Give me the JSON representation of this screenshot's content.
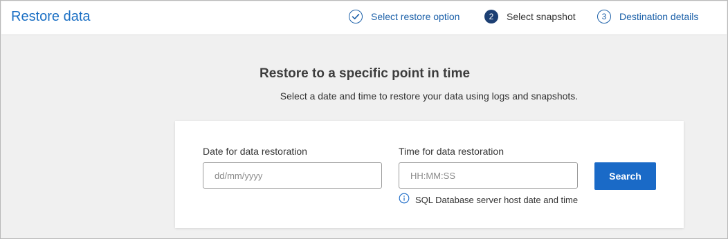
{
  "header": {
    "title": "Restore data",
    "steps": [
      {
        "number": "✓",
        "label": "Select restore option",
        "state": "complete"
      },
      {
        "number": "2",
        "label": "Select snapshot",
        "state": "current"
      },
      {
        "number": "3",
        "label": "Destination details",
        "state": "upcoming"
      }
    ]
  },
  "main": {
    "heading": "Restore to a specific point in time",
    "subheading": "Select a date and time to restore your data using logs and snapshots."
  },
  "form": {
    "date_label": "Date for data restoration",
    "date_placeholder": "dd/mm/yyyy",
    "date_value": "",
    "time_label": "Time for data restoration",
    "time_placeholder": "HH:MM:SS",
    "time_value": "",
    "search_label": "Search",
    "time_hint": "SQL Database server host date and time"
  },
  "colors": {
    "accent": "#1a6ac7",
    "active_step": "#1c3f73",
    "link": "#1a5fa8",
    "background": "#f0f0f0"
  },
  "icons": {
    "step_complete": "check-icon",
    "hint": "info-icon"
  }
}
